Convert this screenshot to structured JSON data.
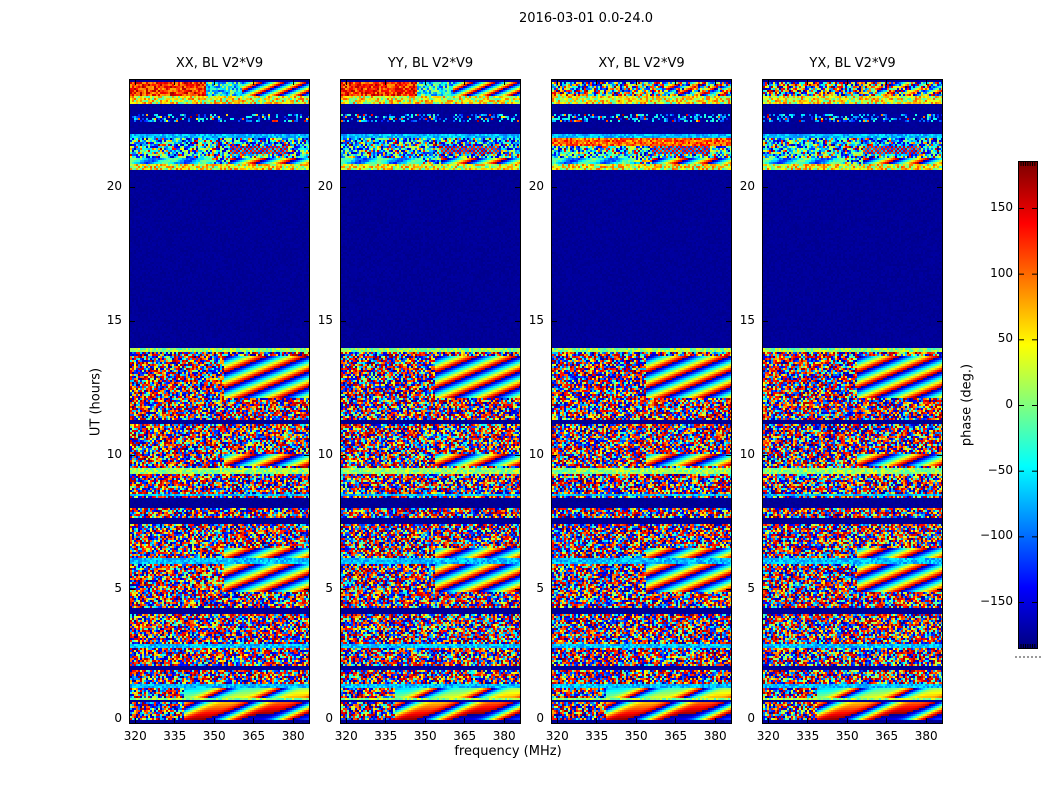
{
  "figure": {
    "title": "2016-03-01 0.0-24.0",
    "background": "#ffffff"
  },
  "chart_data": {
    "type": "heatmap",
    "title": "2016-03-01 0.0-24.0",
    "xlabel": "frequency (MHz)",
    "ylabel": "UT (hours)",
    "x_range": [
      318,
      386
    ],
    "y_range": [
      0,
      24
    ],
    "x_ticks": [
      320,
      335,
      350,
      365,
      380
    ],
    "x_tick_labels": [
      "320",
      "335",
      "350",
      "365",
      "380"
    ],
    "y_ticks": [
      0,
      5,
      10,
      15,
      20
    ],
    "y_tick_labels": [
      "0",
      "5",
      "10",
      "15",
      "20"
    ],
    "grid": false,
    "colormap": "jet",
    "colorbar": {
      "label": "phase (deg.)",
      "range": [
        -185,
        185
      ],
      "ticks": [
        150,
        100,
        50,
        0,
        -50,
        -100,
        -150
      ],
      "tick_labels": [
        "150",
        "100",
        "50",
        "0",
        "−50",
        "−100",
        "−150"
      ],
      "top_color": "#8b0000",
      "bottom_color": "#000080"
    },
    "panels": [
      {
        "title": "XX, BL V2*V9",
        "top_band_style": "red-left",
        "main_band_style": "blue-noise",
        "seed": 11
      },
      {
        "title": "YY, BL V2*V9",
        "top_band_style": "red-left",
        "main_band_style": "blue-noise",
        "seed": 227
      },
      {
        "title": "XY, BL V2*V9",
        "top_band_style": "noise",
        "main_band_style": "orange",
        "seed": 733
      },
      {
        "title": "YX, BL V2*V9",
        "top_band_style": "noise",
        "main_band_style": "mixed",
        "seed": 941
      }
    ],
    "structure": {
      "description": "per-pixel pseudo-random interferometric phase; blank (flagged) navy block mid-track",
      "blank_band": [
        14.03,
        20.65
      ],
      "row_seed": 1234,
      "top_stripes": [
        {
          "t0": 23.3,
          "t1": 24.0,
          "style": "top-band"
        },
        {
          "t0": 23.12,
          "t1": 23.3,
          "style": "speck-green"
        },
        {
          "t0": 22.5,
          "t1": 22.75,
          "style": "speck-blue"
        },
        {
          "t0": 21.85,
          "t1": 22.0,
          "style": "cyan"
        },
        {
          "t0": 20.9,
          "t1": 21.85,
          "style": "main-band"
        },
        {
          "t0": 20.65,
          "t1": 20.9,
          "style": "speck-green"
        }
      ],
      "active_special_bands": [
        {
          "t0": 13.85,
          "t1": 14.03,
          "style": "green"
        },
        {
          "t0": 11.2,
          "t1": 11.38,
          "style": "navy"
        },
        {
          "t0": 9.3,
          "t1": 9.55,
          "style": "green"
        },
        {
          "t0": 8.05,
          "t1": 8.45,
          "style": "navy"
        },
        {
          "t0": 6.0,
          "t1": 6.18,
          "style": "cyan"
        },
        {
          "t0": 4.1,
          "t1": 4.35,
          "style": "navy"
        },
        {
          "t0": 2.0,
          "t1": 2.15,
          "style": "navy"
        }
      ],
      "fringe_bands": [
        [
          0.15,
          1.4
        ],
        [
          4.9,
          6.6
        ],
        [
          9.6,
          10.1
        ],
        [
          12.2,
          13.7
        ]
      ]
    }
  }
}
